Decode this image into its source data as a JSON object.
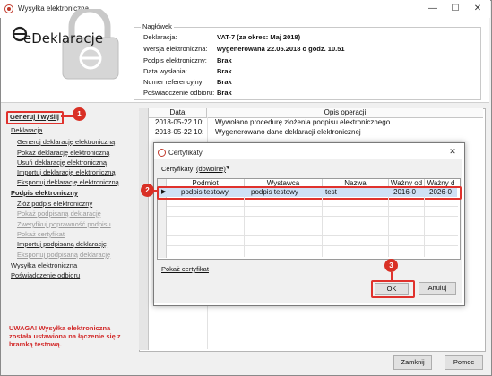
{
  "window": {
    "title": "Wysyłka elektroniczna",
    "minimize": "—",
    "maximize": "☐",
    "close": "✕"
  },
  "logo": {
    "text": "eDeklaracje"
  },
  "header": {
    "legend": "Nagłówek",
    "rows": [
      {
        "label": "Deklaracja:",
        "value": "VAT-7 (za okres: Maj 2018)"
      },
      {
        "label": "Wersja elektroniczna:",
        "value": "wygenerowana 22.05.2018 o godz. 10.51"
      },
      {
        "label": "Podpis elektroniczny:",
        "value": "Brak"
      },
      {
        "label": "Data wysłania:",
        "value": "Brak"
      },
      {
        "label": "Numer referencyjny:",
        "value": "Brak"
      },
      {
        "label": "Poświadczenie odbioru:",
        "value": "Brak"
      }
    ]
  },
  "sidebar": {
    "items": [
      {
        "label": "Generuj i wyślij"
      },
      {
        "label": "Deklaracja"
      },
      {
        "label": "Generuj deklarację elektroniczną"
      },
      {
        "label": "Pokaż deklarację elektroniczną"
      },
      {
        "label": "Usuń deklarację elektroniczną"
      },
      {
        "label": "Importuj deklarację elektroniczną"
      },
      {
        "label": "Eksportuj deklarację elektroniczną"
      },
      {
        "label": "Podpis elektroniczny"
      },
      {
        "label": "Złóż podpis elektroniczny"
      },
      {
        "label": "Pokaż podpisaną deklarację"
      },
      {
        "label": "Zweryfikuj poprawność podpisu"
      },
      {
        "label": "Pokaż certyfikat"
      },
      {
        "label": "Importuj podpisaną deklarację"
      },
      {
        "label": "Eksportuj podpisaną deklarację"
      },
      {
        "label": "Wysyłka elektroniczna"
      },
      {
        "label": "Poświadczenie odbioru"
      }
    ],
    "warning": "UWAGA! Wysyłka elektroniczna została ustawiona na łączenie się z bramką testową."
  },
  "log": {
    "columns": [
      "Data",
      "Opis operacji"
    ],
    "rows": [
      {
        "date": "2018-05-22 10:",
        "desc": "Wywołano procedurę złożenia podpisu elektronicznego"
      },
      {
        "date": "2018-05-22 10:",
        "desc": "Wygenerowano dane deklaracji elektronicznej"
      }
    ]
  },
  "dialog": {
    "title": "Certyfikaty",
    "close": "✕",
    "filter_label": "Certyfikaty:",
    "filter_value": "(dowolne)",
    "columns": [
      "Podmiot",
      "Wystawca",
      "Nazwa",
      "Ważny od",
      "Ważny d"
    ],
    "rows": [
      {
        "podmiot": "podpis testowy",
        "wystawca": "podpis testowy",
        "nazwa": "test",
        "od": "2016-0",
        "do": "2026-0"
      }
    ],
    "show_cert": "Pokaż certyfikat",
    "ok": "OK",
    "cancel": "Anuluj"
  },
  "badges": [
    "1",
    "2",
    "3"
  ],
  "footer": {
    "close": "Zamknij",
    "help": "Pomoc"
  },
  "colors": {
    "highlight": "#e0322d",
    "selected_row": "#cfe0f5",
    "warning": "#d22b2b"
  }
}
